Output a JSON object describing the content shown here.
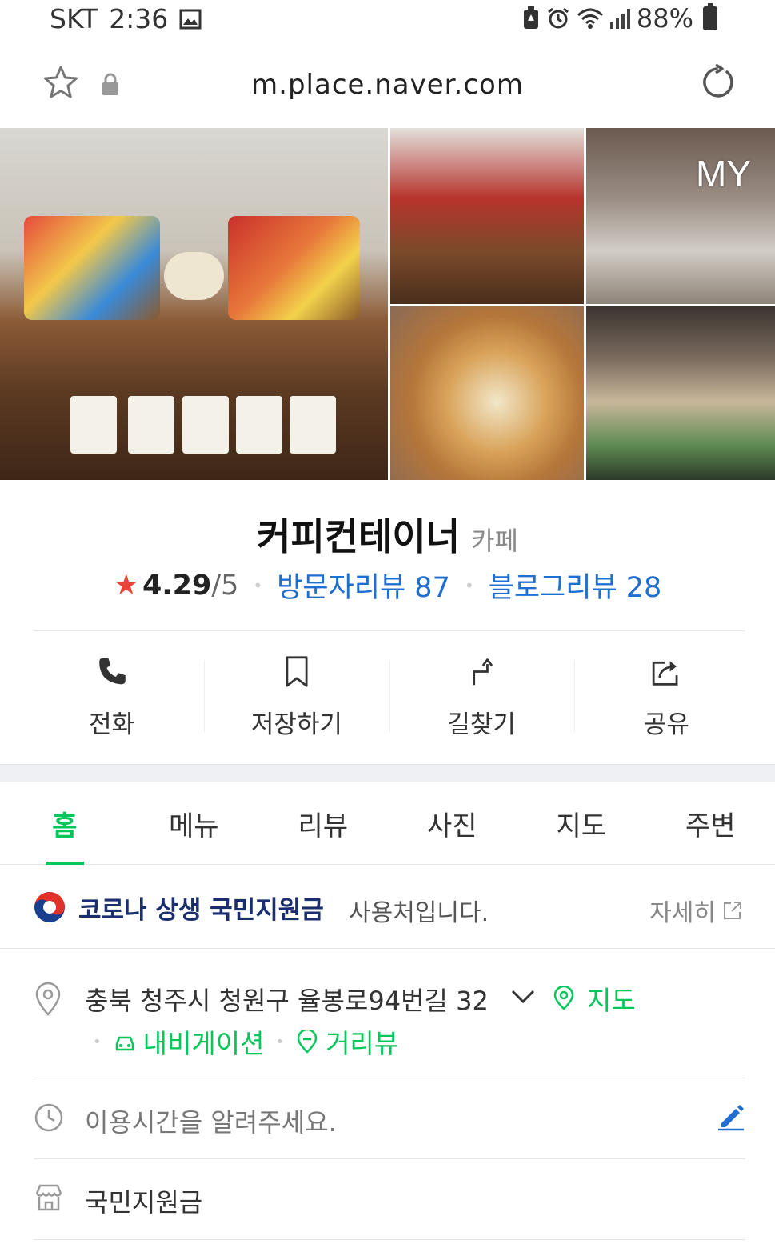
{
  "status_bar": {
    "carrier": "SKT",
    "time": "2:36",
    "battery": "88%"
  },
  "browser": {
    "url": "m.place.naver.com"
  },
  "photos": {
    "badge": "MY"
  },
  "place": {
    "name": "커피컨테이너",
    "category": "카페",
    "rating": "4.29",
    "rating_total": "/5",
    "visitor_reviews": "방문자리뷰 87",
    "blog_reviews": "블로그리뷰 28"
  },
  "actions": {
    "call": "전화",
    "save": "저장하기",
    "directions": "길찾기",
    "share": "공유"
  },
  "tabs": [
    "홈",
    "메뉴",
    "리뷰",
    "사진",
    "지도",
    "주변"
  ],
  "banner": {
    "strong": "코로나 상생 국민지원금",
    "rest": "사용처입니다.",
    "more": "자세히"
  },
  "info": {
    "address": "충북 청주시 청원구 율봉로94번길 32",
    "map_link": "지도",
    "navigation": "내비게이션",
    "street_view": "거리뷰",
    "hours": "이용시간을 알려주세요.",
    "support": "국민지원금"
  },
  "colors": {
    "naver_green": "#03c75a",
    "link_blue": "#1f6fd1",
    "star_red": "#e8443a"
  }
}
